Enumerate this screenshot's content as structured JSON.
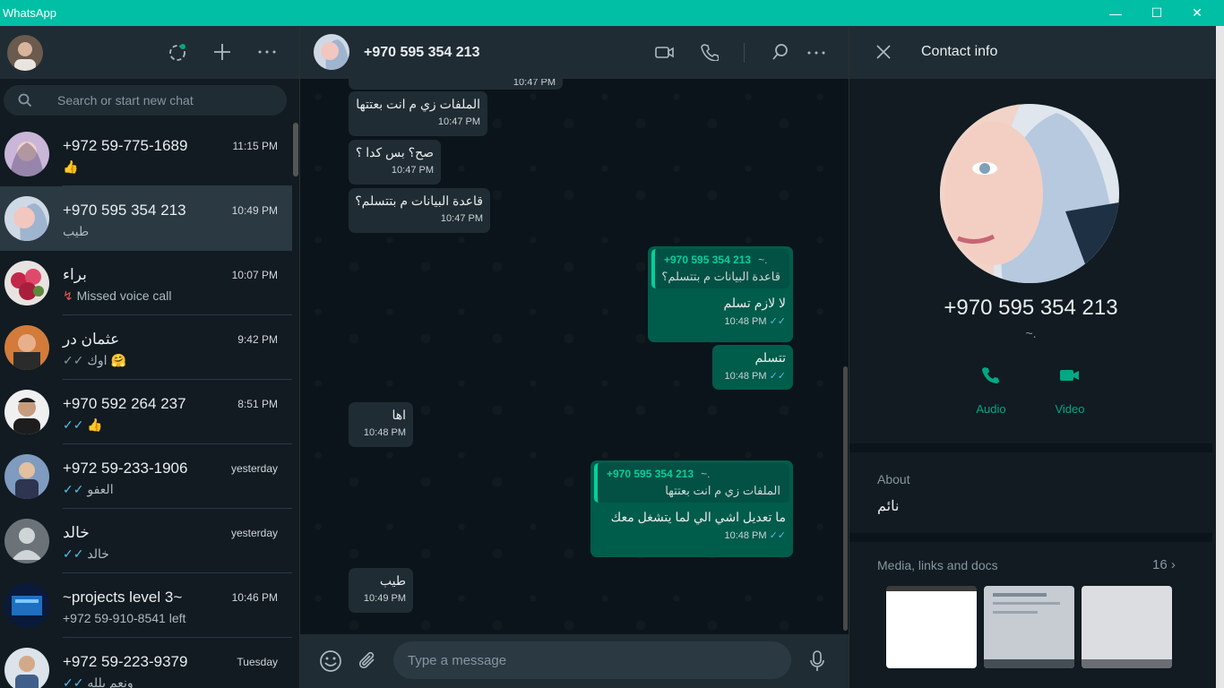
{
  "window": {
    "app_name": "WhatsApp",
    "minimize": "—",
    "maximize": "☐",
    "close": "✕"
  },
  "left": {
    "search_placeholder": "Search or start new chat",
    "chats": [
      {
        "name": "+972 59-775-1689",
        "time": "11:15 PM",
        "preview": "👍",
        "active": false
      },
      {
        "name": "+970 595 354 213",
        "time": "10:49 PM",
        "preview": "طيب",
        "active": true
      },
      {
        "name": "براء",
        "time": "10:07 PM",
        "preview": "Missed voice call",
        "preview_icon": "missed-call-icon",
        "active": false
      },
      {
        "name": "عثمان در",
        "time": "9:42 PM",
        "preview": "اوك 🤗",
        "ticks": "✓✓",
        "active": false
      },
      {
        "name": "+970 592 264 237",
        "time": "8:51 PM",
        "preview": "👍",
        "ticks": "✓✓",
        "active": false
      },
      {
        "name": "+972 59-233-1906",
        "time": "yesterday",
        "preview": "العفو",
        "ticks": "✓✓",
        "active": false
      },
      {
        "name": "خالد",
        "time": "yesterday",
        "preview": "خالد",
        "ticks": "✓✓",
        "active": false
      },
      {
        "name": "~projects level 3~",
        "time": "10:46 PM",
        "preview": "+972 59-910-8541 left",
        "active": false
      },
      {
        "name": "+972 59-223-9379",
        "time": "Tuesday",
        "preview": "ونعم بلله",
        "ticks": "✓✓",
        "active": false
      }
    ]
  },
  "middle": {
    "contact_title": "+970 595 354 213",
    "top_partial_time": "10:47 PM",
    "messages": [
      {
        "dir": "in",
        "text": "الملفات زي م انت بعتتها",
        "time": "10:47 PM"
      },
      {
        "dir": "in",
        "text": "صح؟ بس كدا ؟",
        "time": "10:47 PM"
      },
      {
        "dir": "in",
        "text": "قاعدة البيانات م بتتسلم؟",
        "time": "10:47 PM"
      },
      {
        "dir": "out",
        "quote_author": "+970 595 354 213",
        "quote_tilde": "~.",
        "quote_text": "قاعدة البيانات م بتتسلم؟",
        "text": "لا لازم تسلم",
        "time": "10:48 PM",
        "ticks": "✓✓"
      },
      {
        "dir": "out",
        "text": "تتسلم",
        "time": "10:48 PM",
        "ticks": "✓✓"
      },
      {
        "dir": "in",
        "text": "اها",
        "time": "10:48 PM"
      },
      {
        "dir": "out",
        "quote_author": "+970 595 354 213",
        "quote_tilde": "~.",
        "quote_text": "الملفات زي م انت بعتتها",
        "text": "ما تعديل  اشي الي لما  يتشغل  معك",
        "time": "10:48 PM",
        "ticks": "✓✓"
      },
      {
        "dir": "in",
        "text": "طيب",
        "time": "10:49 PM"
      }
    ],
    "composer_placeholder": "Type a message"
  },
  "right": {
    "title": "Contact info",
    "phone": "+970 595 354 213",
    "tilde": "~.",
    "audio_label": "Audio",
    "video_label": "Video",
    "about_title": "About",
    "about_text": "نائم",
    "media_title": "Media, links and docs",
    "media_count": "16"
  },
  "colors": {
    "accent": "#00bfa5",
    "outgoing_bubble": "#005c4b",
    "incoming_bubble": "#202c33",
    "read_ticks": "#53bdeb",
    "action_green": "#00a884"
  }
}
